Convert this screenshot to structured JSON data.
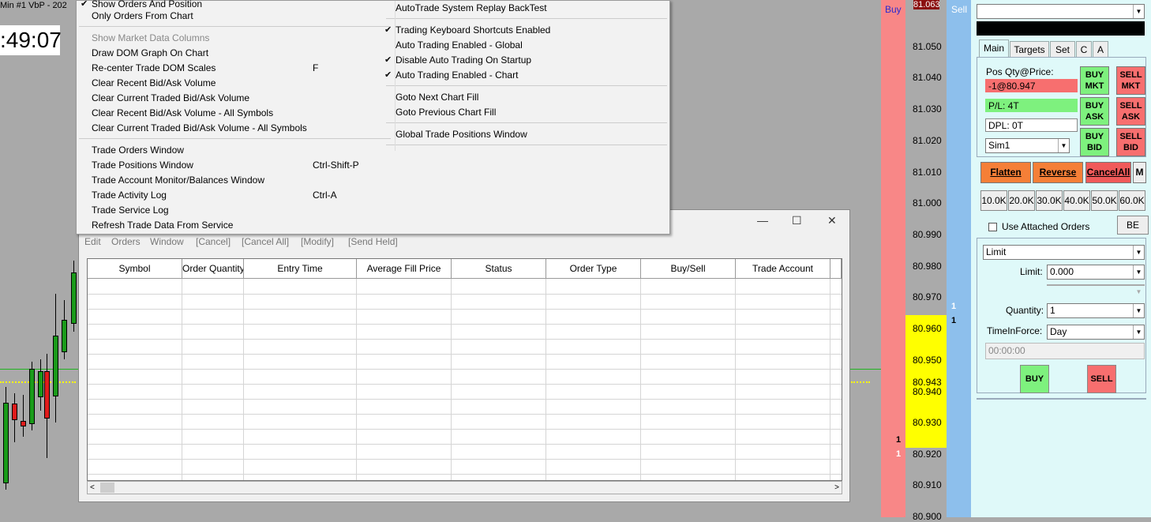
{
  "chart": {
    "header": "Min  #1 VbP - 202",
    "clock": ":49:07"
  },
  "menu": {
    "left_items": [
      {
        "label": "Show Orders And Position",
        "checked": true,
        "disabled": false,
        "shortcut": ""
      },
      {
        "label": "Only Orders From Chart",
        "checked": false,
        "disabled": false,
        "shortcut": ""
      },
      {
        "label": "Show Market Data Columns",
        "checked": false,
        "disabled": true,
        "shortcut": ""
      },
      {
        "label": "Draw DOM Graph On Chart",
        "checked": false,
        "disabled": false,
        "shortcut": ""
      },
      {
        "label": "Re-center Trade DOM Scales",
        "checked": false,
        "disabled": false,
        "shortcut": "F"
      },
      {
        "label": "Clear Recent Bid/Ask Volume",
        "checked": false,
        "disabled": false,
        "shortcut": ""
      },
      {
        "label": "Clear Current Traded Bid/Ask Volume",
        "checked": false,
        "disabled": false,
        "shortcut": ""
      },
      {
        "label": "Clear Recent Bid/Ask Volume - All Symbols",
        "checked": false,
        "disabled": false,
        "shortcut": ""
      },
      {
        "label": "Clear Current Traded Bid/Ask Volume - All Symbols",
        "checked": false,
        "disabled": false,
        "shortcut": ""
      },
      {
        "label": "Trade Orders Window",
        "checked": false,
        "disabled": false,
        "shortcut": ""
      },
      {
        "label": "Trade Positions Window",
        "checked": false,
        "disabled": false,
        "shortcut": "Ctrl-Shift-P"
      },
      {
        "label": "Trade Account Monitor/Balances Window",
        "checked": false,
        "disabled": false,
        "shortcut": ""
      },
      {
        "label": "Trade Activity Log",
        "checked": false,
        "disabled": false,
        "shortcut": "Ctrl-A"
      },
      {
        "label": "Trade Service Log",
        "checked": false,
        "disabled": false,
        "shortcut": ""
      },
      {
        "label": "Refresh Trade Data From Service",
        "checked": false,
        "disabled": false,
        "shortcut": ""
      }
    ],
    "right_items": [
      {
        "label": "AutoTrade System Replay BackTest",
        "checked": false
      },
      {
        "label": "Trading Keyboard Shortcuts Enabled",
        "checked": true
      },
      {
        "label": "Auto Trading Enabled - Global",
        "checked": false
      },
      {
        "label": "Disable Auto Trading On Startup",
        "checked": true
      },
      {
        "label": "Auto Trading Enabled - Chart",
        "checked": true
      },
      {
        "label": "Goto Next Chart Fill",
        "checked": false
      },
      {
        "label": "Goto Previous Chart Fill",
        "checked": false
      },
      {
        "label": "Global Trade Positions Window",
        "checked": false
      }
    ],
    "check_glyph": "✔"
  },
  "orders_window": {
    "menu": [
      "Edit",
      "Orders",
      "Window",
      "[Cancel]",
      "[Cancel All]",
      "[Modify]",
      "[Send Held]"
    ],
    "columns": [
      "Symbol",
      "Order Quantity",
      "Entry Time",
      "Average Fill Price",
      "Status",
      "Order Type",
      "Buy/Sell",
      "Trade Account"
    ],
    "controls": {
      "minimize": "—",
      "maximize": "☐",
      "close": "✕"
    }
  },
  "dom": {
    "buy_header": "Buy",
    "sell_header": "Sell",
    "top_price": "81.063",
    "prices": [
      "81.050",
      "81.040",
      "81.030",
      "81.020",
      "81.010",
      "81.000",
      "80.990",
      "80.980",
      "80.970",
      "80.960",
      "80.950",
      "80.943",
      "80.940",
      "80.930",
      "80.920",
      "80.910",
      "80.900"
    ],
    "sell_qty_a": "1",
    "sell_qty_b": "1",
    "buy_qty_a": "1",
    "buy_qty_b": "1"
  },
  "trade_panel": {
    "tabs": [
      "Main",
      "Targets",
      "Set",
      "C",
      "A"
    ],
    "pos_label": "Pos Qty@Price:",
    "pos_value": "-1@80.947",
    "pl": "P/L: 4T",
    "dpl": "DPL: 0T",
    "account": "Sim1",
    "buttons": {
      "buy_mkt": "BUY\nMKT",
      "sell_mkt": "SELL\nMKT",
      "buy_ask": "BUY\nASK",
      "sell_ask": "SELL\nASK",
      "buy_bid": "BUY\nBID",
      "sell_bid": "SELL\nBID",
      "flatten": "Flatten",
      "reverse": "Reverse",
      "cancel_all": "CancelAll",
      "m": "M",
      "be": "BE",
      "buy": "BUY",
      "sell": "SELL"
    },
    "qty_buttons": [
      "10.0K",
      "20.0K",
      "30.0K",
      "40.0K",
      "50.0K",
      "60.0K"
    ],
    "use_attached": "Use Attached Orders",
    "order_type": "Limit",
    "limit_label": "Limit:",
    "limit_value": "0.000",
    "quantity_label": "Quantity:",
    "quantity_value": "1",
    "tif_label": "TimeInForce:",
    "tif_value": "Day",
    "time_value": "00:00:00",
    "colors": {
      "green": "#7ef17e",
      "red": "#f76f6f",
      "orange": "#f57f37"
    }
  }
}
